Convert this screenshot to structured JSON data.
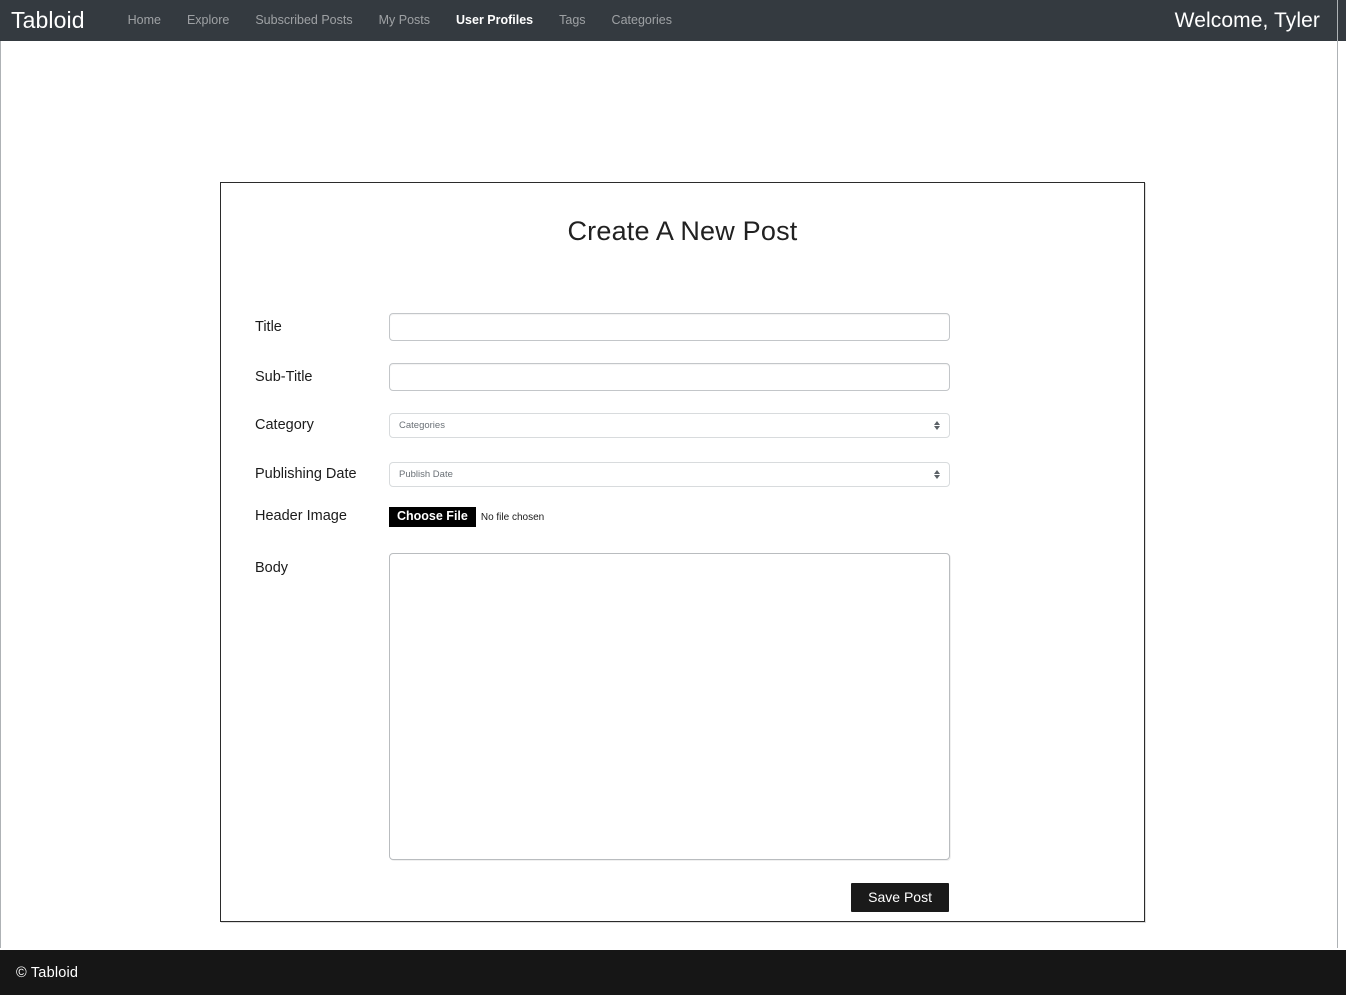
{
  "navbar": {
    "brand": "Tabloid",
    "links": [
      {
        "label": "Home",
        "active": false
      },
      {
        "label": "Explore",
        "active": false
      },
      {
        "label": "Subscribed Posts",
        "active": false
      },
      {
        "label": "My Posts",
        "active": false
      },
      {
        "label": "User Profiles",
        "active": true
      },
      {
        "label": "Tags",
        "active": false
      },
      {
        "label": "Categories",
        "active": false
      }
    ],
    "welcome": "Welcome, Tyler",
    "background_color": "#343a40"
  },
  "card": {
    "title": "Create A New Post",
    "border_color": "#2b2b2b"
  },
  "form": {
    "title_field": {
      "label": "Title",
      "value": "",
      "placeholder": ""
    },
    "subtitle_field": {
      "label": "Sub-Title",
      "value": "",
      "placeholder": ""
    },
    "category_field": {
      "label": "Category",
      "selected": "Categories"
    },
    "publishing_date_field": {
      "label": "Publishing Date",
      "selected": "Publish Date"
    },
    "header_image_field": {
      "label": "Header Image",
      "button_label": "Choose File",
      "status": "No file chosen"
    },
    "body_field": {
      "label": "Body",
      "value": "",
      "placeholder": ""
    },
    "save_button": "Save Post"
  },
  "footer": {
    "text": "© Tabloid",
    "background_color": "#161616"
  }
}
